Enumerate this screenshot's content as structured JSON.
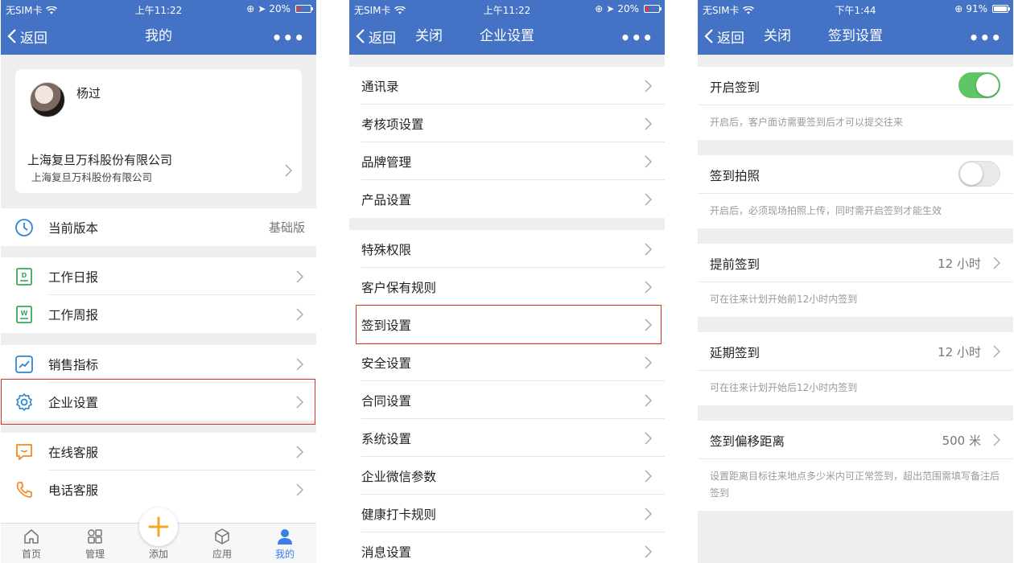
{
  "status_bars": [
    {
      "carrier": "无SIM卡",
      "time": "上午11:22",
      "battery": "20%"
    },
    {
      "carrier": "无SIM卡",
      "time": "上午11:22",
      "battery": "20%"
    },
    {
      "carrier": "无SIM卡",
      "time": "下午1:44",
      "battery": "91%"
    }
  ],
  "colors": {
    "nav_blue": "#4472c4",
    "highlight_red": "#e0302a",
    "toggle_green": "#5fc666",
    "active_tab": "#3a7ee8"
  },
  "screen1": {
    "nav": {
      "back": "返回",
      "title": "我的",
      "more": "•••"
    },
    "profile": {
      "name": "杨过",
      "company": "上海复旦万科股份有限公司",
      "company_sub": "上海复旦万科股份有限公司"
    },
    "version": {
      "label": "当前版本",
      "value": "基础版",
      "icon": "clock-icon"
    },
    "reports": [
      {
        "label": "工作日报",
        "icon": "daily-report-icon"
      },
      {
        "label": "工作周报",
        "icon": "weekly-report-icon"
      }
    ],
    "sales": [
      {
        "label": "销售指标",
        "icon": "chart-icon"
      },
      {
        "label": "企业设置",
        "icon": "gear-icon"
      }
    ],
    "service": [
      {
        "label": "在线客服",
        "icon": "chat-icon"
      },
      {
        "label": "电话客服",
        "icon": "phone-icon"
      }
    ],
    "tabs": [
      {
        "label": "首页",
        "icon": "home-icon"
      },
      {
        "label": "管理",
        "icon": "grid-icon"
      },
      {
        "label": "添加",
        "icon": "plus-icon"
      },
      {
        "label": "应用",
        "icon": "cube-icon"
      },
      {
        "label": "我的",
        "icon": "person-icon"
      }
    ]
  },
  "screen2": {
    "nav": {
      "back": "返回",
      "close": "关闭",
      "title": "企业设置",
      "more": "•••"
    },
    "group1": [
      "通讯录",
      "考核项设置",
      "品牌管理",
      "产品设置"
    ],
    "group2": [
      "特殊权限",
      "客户保有规则",
      "签到设置",
      "安全设置",
      "合同设置",
      "系统设置",
      "企业微信参数",
      "健康打卡规则",
      "消息设置"
    ]
  },
  "screen3": {
    "nav": {
      "back": "返回",
      "close": "关闭",
      "title": "签到设置",
      "more": "•••"
    },
    "enable": {
      "label": "开启签到",
      "on": true,
      "hint": "开启后，客户面访需要签到后才可以提交往来"
    },
    "photo": {
      "label": "签到拍照",
      "on": false,
      "hint": "开启后，必须现场拍照上传，同时需开启签到才能生效"
    },
    "early": {
      "label": "提前签到",
      "value": "12 小时",
      "hint": "可在往来计划开始前12小时内签到"
    },
    "late": {
      "label": "延期签到",
      "value": "12 小时",
      "hint": "可在往来计划开始后12小时内签到"
    },
    "offset": {
      "label": "签到偏移距离",
      "value": "500 米",
      "hint": "设置距离目标往来地点多少米内可正常签到，超出范围需填写备注后签到"
    }
  }
}
